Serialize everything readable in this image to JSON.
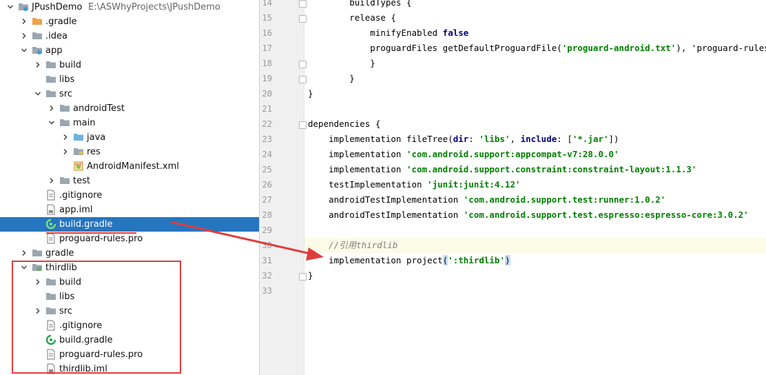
{
  "project_tree": {
    "root": {
      "name": "JPushDemo",
      "path": "E:\\ASWhyProjects\\JPushDemo"
    },
    "rows": [
      {
        "label": "JPushDemo",
        "icon": "module-folder-icon",
        "arrow": "down",
        "indent": 0
      },
      {
        "label": ".gradle",
        "icon": "orange-folder-icon",
        "arrow": "right",
        "indent": 1
      },
      {
        "label": ".idea",
        "icon": "folder-icon",
        "arrow": "right",
        "indent": 1
      },
      {
        "label": "app",
        "icon": "module-folder-icon",
        "arrow": "down",
        "indent": 1
      },
      {
        "label": "build",
        "icon": "folder-icon",
        "arrow": "right",
        "indent": 2
      },
      {
        "label": "libs",
        "icon": "folder-icon",
        "arrow": "none",
        "indent": 2
      },
      {
        "label": "src",
        "icon": "folder-icon",
        "arrow": "down",
        "indent": 2
      },
      {
        "label": "androidTest",
        "icon": "folder-icon",
        "arrow": "right",
        "indent": 3
      },
      {
        "label": "main",
        "icon": "folder-icon",
        "arrow": "down",
        "indent": 3
      },
      {
        "label": "java",
        "icon": "source-folder-icon",
        "arrow": "right",
        "indent": 4
      },
      {
        "label": "res",
        "icon": "resource-folder-icon",
        "arrow": "right",
        "indent": 4
      },
      {
        "label": "AndroidManifest.xml",
        "icon": "manifest-icon",
        "arrow": "none",
        "indent": 4
      },
      {
        "label": "test",
        "icon": "folder-icon",
        "arrow": "right",
        "indent": 3
      },
      {
        "label": ".gitignore",
        "icon": "file-icon",
        "arrow": "none",
        "indent": 2
      },
      {
        "label": "app.iml",
        "icon": "iml-file-icon",
        "arrow": "none",
        "indent": 2
      },
      {
        "label": "build.gradle",
        "icon": "gradle-icon",
        "arrow": "none",
        "indent": 2,
        "selected": true
      },
      {
        "label": "proguard-rules.pro",
        "icon": "file-icon",
        "arrow": "none",
        "indent": 2
      },
      {
        "label": "gradle",
        "icon": "folder-icon",
        "arrow": "right",
        "indent": 1
      },
      {
        "label": "thirdlib",
        "icon": "library-module-icon",
        "arrow": "down",
        "indent": 1
      },
      {
        "label": "build",
        "icon": "folder-icon",
        "arrow": "right",
        "indent": 2
      },
      {
        "label": "libs",
        "icon": "folder-icon",
        "arrow": "none",
        "indent": 2
      },
      {
        "label": "src",
        "icon": "folder-icon",
        "arrow": "right",
        "indent": 2
      },
      {
        "label": ".gitignore",
        "icon": "file-icon",
        "arrow": "none",
        "indent": 2
      },
      {
        "label": "build.gradle",
        "icon": "gradle-icon",
        "arrow": "none",
        "indent": 2
      },
      {
        "label": "proguard-rules.pro",
        "icon": "file-icon",
        "arrow": "none",
        "indent": 2
      },
      {
        "label": "thirdlib.iml",
        "icon": "iml-file-icon",
        "arrow": "none",
        "indent": 2
      }
    ]
  },
  "editor": {
    "lines": [
      {
        "n": "14",
        "text": "        buildTypes {"
      },
      {
        "n": "15",
        "text": "        release {"
      },
      {
        "n": "16",
        "text": "            minifyEnabled false"
      },
      {
        "n": "17",
        "text": "            proguardFiles getDefaultProguardFile('proguard-android.txt'), 'proguard-rules."
      },
      {
        "n": "18",
        "text": "            }"
      },
      {
        "n": "19",
        "text": "        }"
      },
      {
        "n": "20",
        "text": "}"
      },
      {
        "n": "21",
        "text": ""
      },
      {
        "n": "22",
        "text": "dependencies {"
      },
      {
        "n": "23",
        "text": "    implementation fileTree(dir: 'libs', include: ['*.jar'])"
      },
      {
        "n": "24",
        "text": "    implementation 'com.android.support:appcompat-v7:28.0.0'"
      },
      {
        "n": "25",
        "text": "    implementation 'com.android.support.constraint:constraint-layout:1.1.3'"
      },
      {
        "n": "26",
        "text": "    testImplementation 'junit:junit:4.12'"
      },
      {
        "n": "27",
        "text": "    androidTestImplementation 'com.android.support.test:runner:1.0.2'"
      },
      {
        "n": "28",
        "text": "    androidTestImplementation 'com.android.support.test.espresso:espresso-core:3.0.2'"
      },
      {
        "n": "29",
        "text": ""
      },
      {
        "n": "30",
        "text": "    //引用thirdlib"
      },
      {
        "n": "31",
        "text": "    implementation project(':thirdlib')"
      },
      {
        "n": "32",
        "text": "}"
      },
      {
        "n": "33",
        "text": ""
      }
    ]
  },
  "colors": {
    "selection": "#2675bf",
    "annotation_red": "#e03c3c",
    "keyword": "#000080",
    "string": "#008000",
    "comment": "#808080"
  }
}
